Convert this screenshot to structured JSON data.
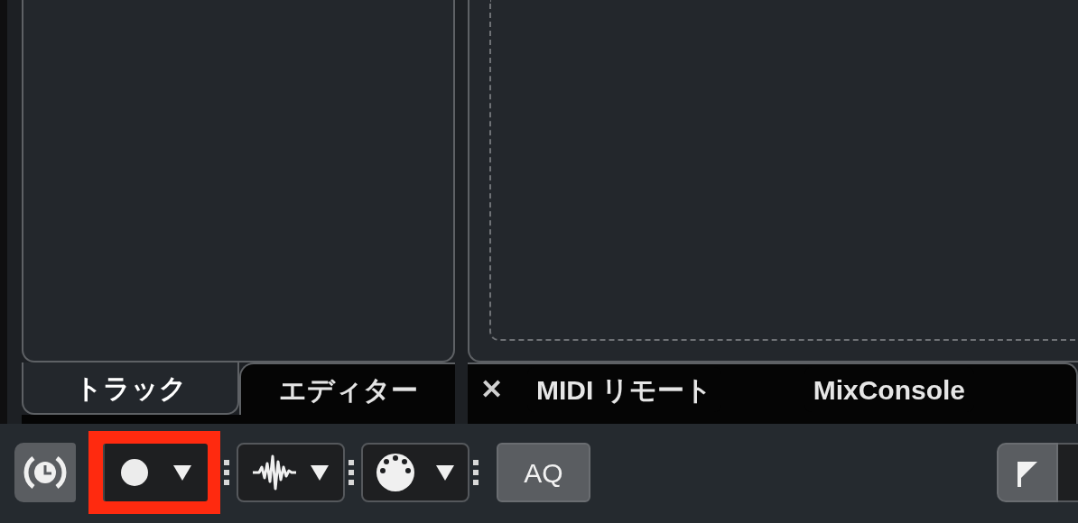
{
  "left_tabs": [
    {
      "label": "トラック",
      "selected": true
    },
    {
      "label": "エディター",
      "selected": false
    }
  ],
  "right_tabs": [
    {
      "kind": "close",
      "label": "✕"
    },
    {
      "kind": "tab",
      "label": "MIDI リモート",
      "selected": false
    },
    {
      "kind": "tab",
      "label": "MixConsole",
      "selected": false
    }
  ],
  "toolbar": {
    "record_highlighted": true,
    "quantize_label": "AQ"
  }
}
